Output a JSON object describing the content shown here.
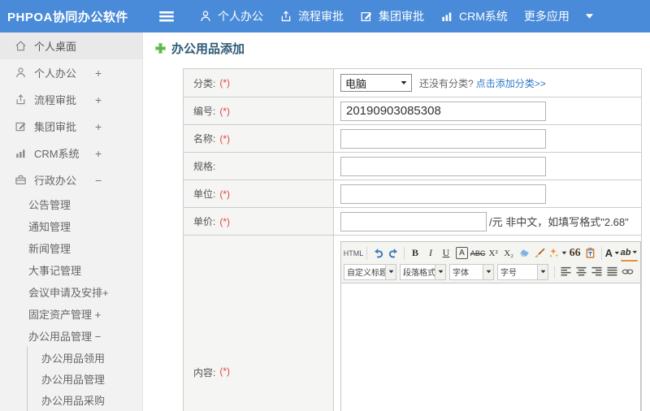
{
  "topbar": {
    "logo": "PHPOA协同办公软件",
    "nav": [
      {
        "label": "个人办公"
      },
      {
        "label": "流程审批"
      },
      {
        "label": "集团审批"
      },
      {
        "label": "CRM系统"
      },
      {
        "label": "更多应用"
      }
    ]
  },
  "sidebar": {
    "items": [
      {
        "label": "个人桌面"
      },
      {
        "label": "个人办公",
        "expander": "+"
      },
      {
        "label": "流程审批",
        "expander": "+"
      },
      {
        "label": "集团审批",
        "expander": "+"
      },
      {
        "label": "CRM系统",
        "expander": "+"
      },
      {
        "label": "行政办公",
        "expander": "−"
      },
      {
        "label": "公告管理"
      },
      {
        "label": "通知管理"
      },
      {
        "label": "新闻管理"
      },
      {
        "label": "大事记管理"
      },
      {
        "label": "会议申请及安排+"
      },
      {
        "label": "固定资产管理 +"
      },
      {
        "label": "办公用品管理 −"
      },
      {
        "label": "办公用品领用"
      },
      {
        "label": "办公用品管理"
      },
      {
        "label": "办公用品采购"
      }
    ]
  },
  "main": {
    "title": "办公用品添加"
  },
  "form": {
    "category": {
      "label": "分类:",
      "required": "(*)",
      "value": "电脑",
      "hint": "还没有分类?",
      "link": "点击添加分类>>"
    },
    "code": {
      "label": "编号:",
      "required": "(*)",
      "value": "20190903085308"
    },
    "name": {
      "label": "名称:",
      "required": "(*)",
      "value": ""
    },
    "spec": {
      "label": "规格:",
      "value": ""
    },
    "unit": {
      "label": "单位:",
      "required": "(*)",
      "value": ""
    },
    "price": {
      "label": "单价:",
      "required": "(*)",
      "value": "",
      "suffix": "/元 非中文，如填写格式\"2.68\""
    },
    "content": {
      "label": "内容:",
      "required": "(*)"
    }
  },
  "editor": {
    "toolbar": {
      "html": "HTML",
      "bold": "B",
      "italic": "I",
      "underline": "U",
      "char_border": "A",
      "strike": "ABC",
      "sup": "X²",
      "sub": "X₂",
      "quote": "66",
      "font_color": "A",
      "bg_color": "ab",
      "combo_title": "自定义标题",
      "combo_paragraph": "段落格式",
      "combo_font": "字体",
      "combo_size": "字号"
    }
  },
  "colors": {
    "topbar_blue": "#4a8bd9",
    "link_blue": "#2e78c7",
    "required_red": "#e64545",
    "title_blue": "#2d5a76",
    "plus_green": "#57b947"
  }
}
